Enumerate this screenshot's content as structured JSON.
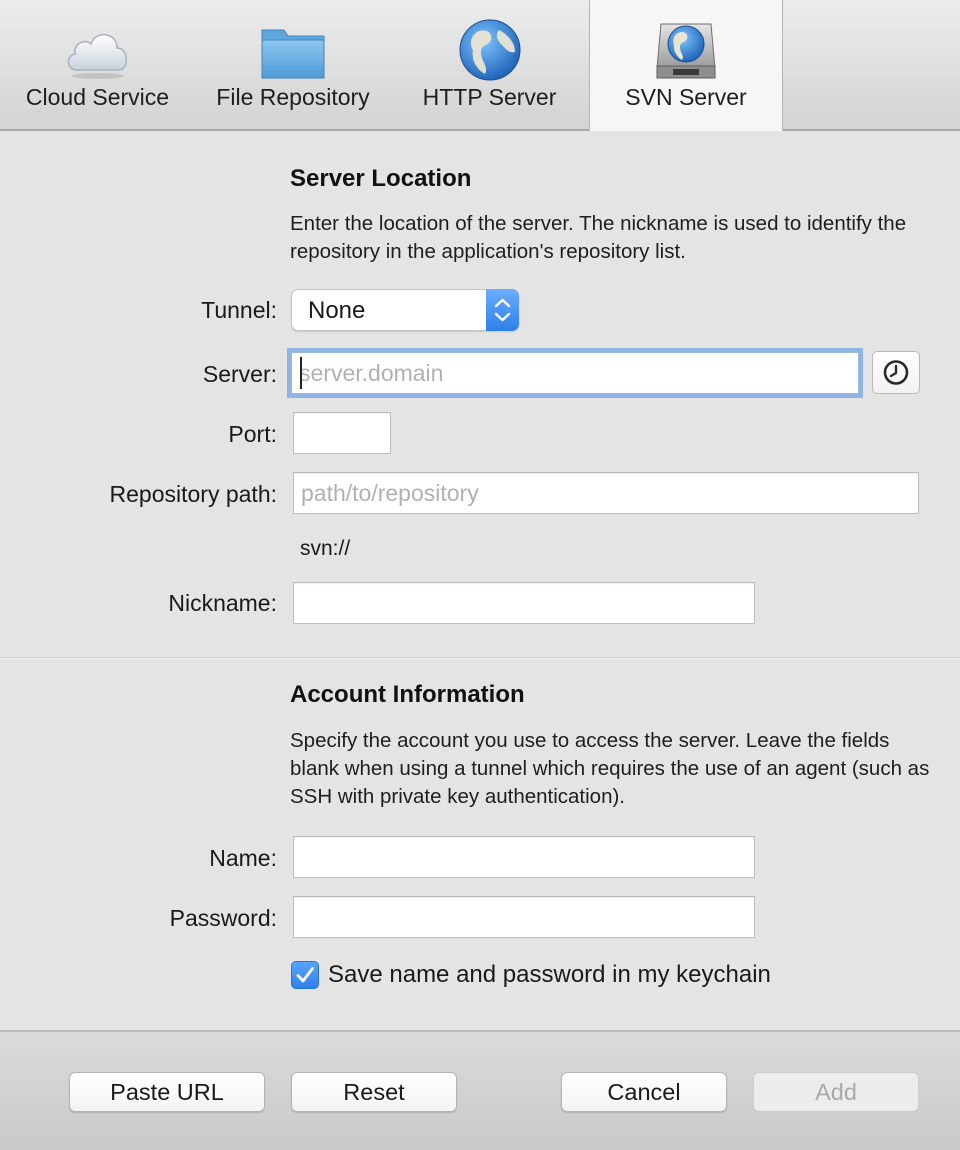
{
  "toolbar": {
    "tabs": [
      {
        "label": "Cloud Service",
        "icon": "cloud-icon"
      },
      {
        "label": "File Repository",
        "icon": "folder-icon"
      },
      {
        "label": "HTTP Server",
        "icon": "globe-icon"
      },
      {
        "label": "SVN Server",
        "icon": "server-globe-icon",
        "active": true
      }
    ]
  },
  "server_location": {
    "title": "Server Location",
    "description": "Enter the location of the server. The nickname is used to identify the repository in the application's repository list.",
    "tunnel_label": "Tunnel:",
    "tunnel_value": "None",
    "server_label": "Server:",
    "server_placeholder": "server.domain",
    "server_value": "",
    "port_label": "Port:",
    "port_value": "",
    "repo_path_label": "Repository path:",
    "repo_path_placeholder": "path/to/repository",
    "repo_path_value": "",
    "protocol_text": "svn://",
    "nickname_label": "Nickname:",
    "nickname_value": ""
  },
  "account": {
    "title": "Account Information",
    "description": "Specify the account you use to access the server. Leave the fields blank when using a tunnel which requires the use of an agent (such as SSH with private key authentication).",
    "name_label": "Name:",
    "name_value": "",
    "password_label": "Password:",
    "password_value": "",
    "save_keychain_label": "Save name and password in my keychain",
    "save_keychain_checked": true
  },
  "buttons": {
    "paste_url": "Paste URL",
    "reset": "Reset",
    "cancel": "Cancel",
    "add": "Add"
  },
  "colors": {
    "accent": "#2f7fe9",
    "focus_ring": "#8fb3e4",
    "disabled_text": "#a9a9a9"
  }
}
